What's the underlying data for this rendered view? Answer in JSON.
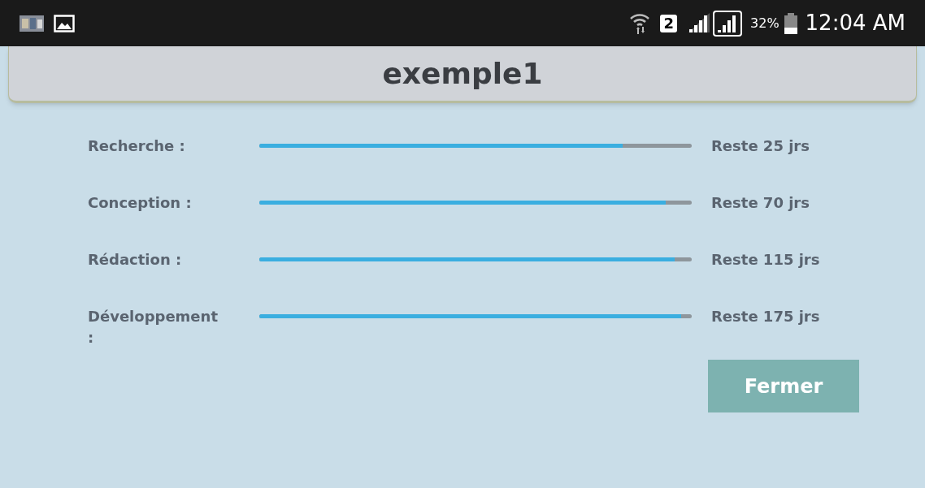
{
  "status_bar": {
    "sim": "2",
    "battery": "32%",
    "time": "12:04 AM"
  },
  "title": "exemple1",
  "tasks": [
    {
      "label": "Recherche :",
      "level": 0.84,
      "remaining": "Reste 25 jrs"
    },
    {
      "label": "Conception :",
      "level": 0.94,
      "remaining": "Reste 70 jrs"
    },
    {
      "label": "Rédaction :",
      "level": 0.96,
      "remaining": "Reste 115 jrs"
    },
    {
      "label": "Développement :",
      "level": 0.975,
      "remaining": "Reste 175 jrs"
    }
  ],
  "button": "Fermer"
}
